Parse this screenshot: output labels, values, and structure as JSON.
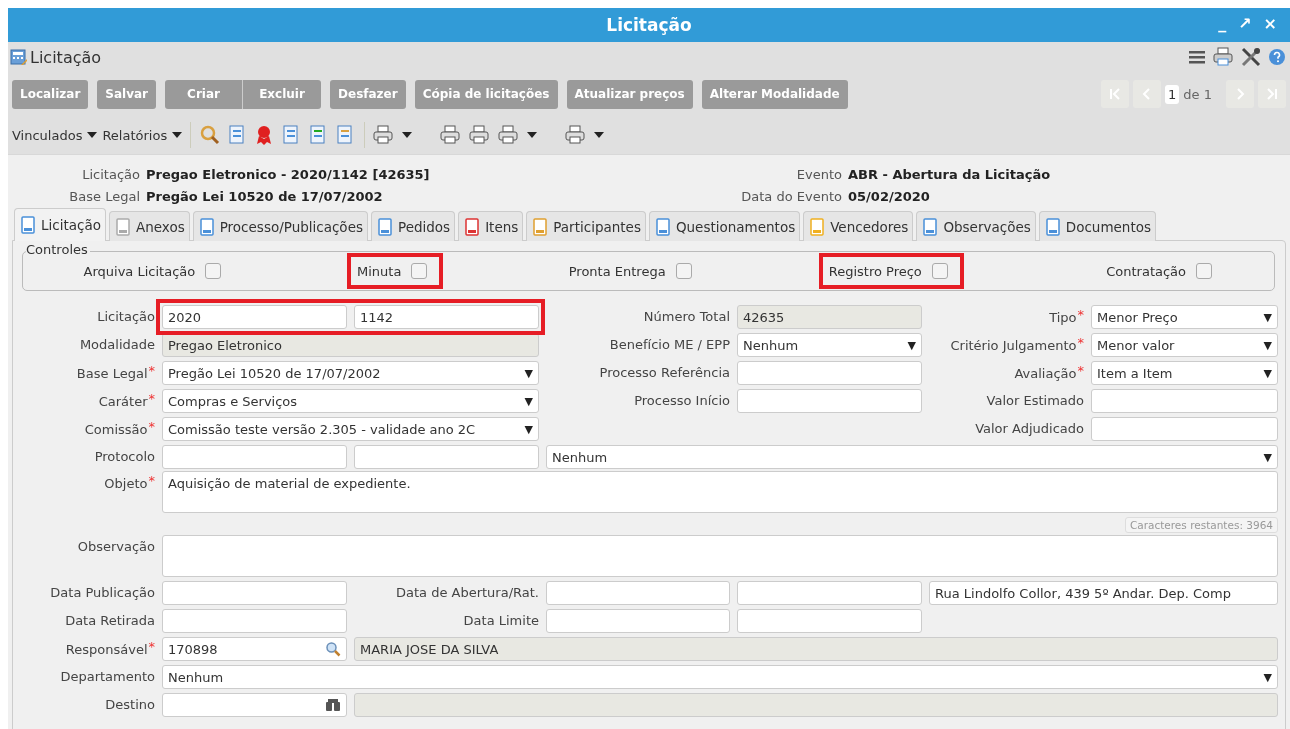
{
  "window": {
    "title": "Licitação",
    "controls": [
      "_",
      "↗",
      "×"
    ]
  },
  "header": {
    "title": "Licitação"
  },
  "buttons": [
    "Localizar",
    "Salvar",
    "Criar",
    "Excluir",
    "Desfazer",
    "Cópia de licitações",
    "Atualizar preços",
    "Alterar Modalidade"
  ],
  "pager": {
    "page": "1",
    "of": "de 1"
  },
  "toolbar": {
    "menus": [
      "Vinculados",
      "Relatórios"
    ]
  },
  "summary": {
    "left": [
      {
        "label": "Licitação",
        "value": "Pregao Eletronico - 2020/1142 [42635]"
      },
      {
        "label": "Base Legal",
        "value": "Pregão Lei 10520 de 17/07/2002"
      }
    ],
    "right": [
      {
        "label": "Evento",
        "value": "ABR - Abertura da Licitação"
      },
      {
        "label": "Data do Evento",
        "value": "05/02/2020"
      }
    ]
  },
  "tabs": [
    {
      "label": "Licitação",
      "selected": true
    },
    {
      "label": "Anexos",
      "selected": false
    },
    {
      "label": "Processo/Publicações",
      "selected": false
    },
    {
      "label": "Pedidos",
      "selected": false
    },
    {
      "label": "Itens",
      "selected": false
    },
    {
      "label": "Participantes",
      "selected": false
    },
    {
      "label": "Questionamentos",
      "selected": false
    },
    {
      "label": "Vencedores",
      "selected": false
    },
    {
      "label": "Observações",
      "selected": false
    },
    {
      "label": "Documentos",
      "selected": false
    }
  ],
  "controls": {
    "legend": "Controles",
    "items": [
      {
        "label": "Arquiva Licitação",
        "checked": false
      },
      {
        "label": "Minuta",
        "checked": false,
        "highlighted": true
      },
      {
        "label": "Pronta Entrega",
        "checked": false
      },
      {
        "label": "Registro Preço",
        "checked": false,
        "highlighted": true
      },
      {
        "label": "Contratação",
        "checked": false
      }
    ]
  },
  "form": {
    "lines": [
      {
        "fields": [
          {
            "label": "Licitação",
            "highlighted": true,
            "inputs": [
              {
                "kind": "input",
                "value": "2020"
              },
              {
                "kind": "input",
                "value": "1142"
              }
            ]
          },
          {
            "label": "Número Total",
            "inputs": [
              {
                "kind": "readonly",
                "value": "42635"
              }
            ]
          },
          {
            "label": "Tipo",
            "required": "*",
            "inputs": [
              {
                "kind": "select",
                "value": "Menor Preço",
                "arrow": "▼"
              }
            ]
          }
        ]
      },
      {
        "fields": [
          {
            "label": "Modalidade",
            "inputs": [
              {
                "kind": "readonly",
                "value": "Pregao Eletronico"
              }
            ]
          },
          {
            "label": "Benefício ME / EPP",
            "inputs": [
              {
                "kind": "select",
                "value": "Nenhum",
                "arrow": "▼"
              }
            ]
          },
          {
            "label": "Critério Julgamento",
            "required": "*",
            "inputs": [
              {
                "kind": "select",
                "value": "Menor valor",
                "arrow": "▼"
              }
            ]
          }
        ]
      },
      {
        "fields": [
          {
            "label": "Base Legal",
            "required": "*",
            "inputs": [
              {
                "kind": "select",
                "value": "Pregão Lei 10520 de 17/07/2002",
                "arrow": "▼"
              }
            ]
          },
          {
            "label": "Processo Referência",
            "inputs": [
              {
                "kind": "input"
              }
            ]
          },
          {
            "label": "Avaliação",
            "required": "*",
            "inputs": [
              {
                "kind": "select",
                "value": "Item a Item",
                "arrow": "▼"
              }
            ]
          }
        ]
      },
      {
        "fields": [
          {
            "label": "Caráter",
            "required": "*",
            "inputs": [
              {
                "kind": "select",
                "value": "Compras e Serviços",
                "arrow": "▼"
              }
            ]
          },
          {
            "label": "Processo Início",
            "inputs": [
              {
                "kind": "input"
              }
            ]
          },
          {
            "label": "Valor Estimado",
            "inputs": [
              {
                "kind": "input"
              }
            ]
          }
        ]
      },
      {
        "fields": [
          {
            "label": "Comissão",
            "required": "*",
            "inputs": [
              {
                "kind": "select",
                "value": "Comissão teste versão 2.305 - validade ano 2C",
                "arrow": "▼"
              }
            ]
          },
          {
            "label": "Valor Adjudicado",
            "inputs": [
              {
                "kind": "input"
              }
            ]
          }
        ]
      },
      {
        "fields": [
          {
            "label": "Protocolo",
            "inputs": [
              {
                "kind": "input"
              },
              {
                "kind": "input"
              },
              {
                "kind": "select",
                "value": "Nenhum",
                "arrow": "▼"
              }
            ]
          }
        ]
      },
      {
        "fields": [
          {
            "label": "Objeto",
            "required": "*",
            "inputs": [
              {
                "kind": "textarea",
                "value": "Aquisição de material de expediente."
              }
            ]
          }
        ]
      },
      {
        "fields": [
          {
            "inputs": [
              {
                "kind": "counter",
                "text": "Caracteres restantes: 3964"
              }
            ]
          }
        ]
      },
      {
        "fields": [
          {
            "label": "Observação",
            "inputs": [
              {
                "kind": "textarea"
              }
            ]
          }
        ]
      },
      {
        "fields": [
          {
            "label": "Data Publicação",
            "inputs": [
              {
                "kind": "input"
              }
            ]
          },
          {
            "label": "Data de Abertura/Rat.",
            "inputs": [
              {
                "kind": "input"
              },
              {
                "kind": "input"
              },
              {
                "kind": "input",
                "value": "Rua Lindolfo Collor, 439 5º Andar. Dep. Comp"
              }
            ]
          }
        ]
      },
      {
        "fields": [
          {
            "label": "Data Retirada",
            "inputs": [
              {
                "kind": "input"
              }
            ]
          },
          {
            "label": "Data Limite",
            "inputs": [
              {
                "kind": "input"
              },
              {
                "kind": "input"
              }
            ]
          }
        ]
      },
      {
        "fields": [
          {
            "label": "Responsável",
            "required": "*",
            "inputs": [
              {
                "kind": "search",
                "value": "170898"
              },
              {
                "kind": "readonly",
                "value": "MARIA JOSE DA SILVA"
              }
            ]
          }
        ]
      },
      {
        "fields": [
          {
            "label": "Departamento",
            "inputs": [
              {
                "kind": "select",
                "value": "Nenhum",
                "arrow": "▼"
              }
            ]
          }
        ]
      },
      {
        "fields": [
          {
            "label": "Destino",
            "inputs": [
              {
                "kind": "binoculars"
              },
              {
                "kind": "readonly"
              }
            ]
          }
        ]
      }
    ]
  }
}
